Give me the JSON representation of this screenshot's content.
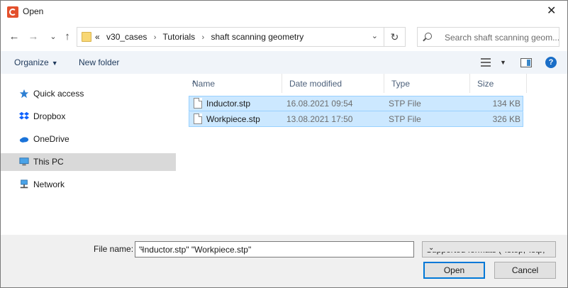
{
  "window": {
    "title": "Open",
    "close_glyph": "✕"
  },
  "nav": {
    "back_glyph": "←",
    "forward_glyph": "→",
    "recent_glyph": "⌄",
    "up_glyph": "↑",
    "breadcrumb": [
      "«",
      "v30_cases",
      "Tutorials",
      "shaft scanning geometry"
    ],
    "separator": "›",
    "refresh_glyph": "↻",
    "dropdown_glyph": "⌄",
    "search_placeholder": "Search shaft scanning geom..."
  },
  "toolbar": {
    "organize_label": "Organize",
    "caret": "▼",
    "new_folder_label": "New folder",
    "views_caret": "▼",
    "help_glyph": "?"
  },
  "sidebar": {
    "items": [
      {
        "label": "Quick access",
        "icon": "star-icon"
      },
      {
        "label": "Dropbox",
        "icon": "dropbox-icon"
      },
      {
        "label": "OneDrive",
        "icon": "cloud-icon"
      },
      {
        "label": "This PC",
        "icon": "computer-icon",
        "selected": true
      },
      {
        "label": "Network",
        "icon": "network-icon"
      }
    ]
  },
  "filelist": {
    "sort_glyph": "^",
    "columns": [
      "Name",
      "Date modified",
      "Type",
      "Size"
    ],
    "rows": [
      {
        "name": "Inductor.stp",
        "date": "16.08.2021 09:54",
        "type": "STP File",
        "size": "134 KB"
      },
      {
        "name": "Workpiece.stp",
        "date": "13.08.2021 17:50",
        "type": "STP File",
        "size": "326 KB"
      }
    ]
  },
  "footer": {
    "filename_label": "File name:",
    "filename_value": "\"Inductor.stp\" \"Workpiece.stp\"",
    "filter_value": "Supported formats (*.step;*.stp;",
    "dropdown_glyph": "⌄",
    "open_label": "Open",
    "cancel_label": "Cancel"
  },
  "colors": {
    "selection_bg": "#cce8ff",
    "selection_border": "#99d1ff",
    "accent": "#0078d7",
    "toolbar_bg": "#f0f4f9"
  }
}
